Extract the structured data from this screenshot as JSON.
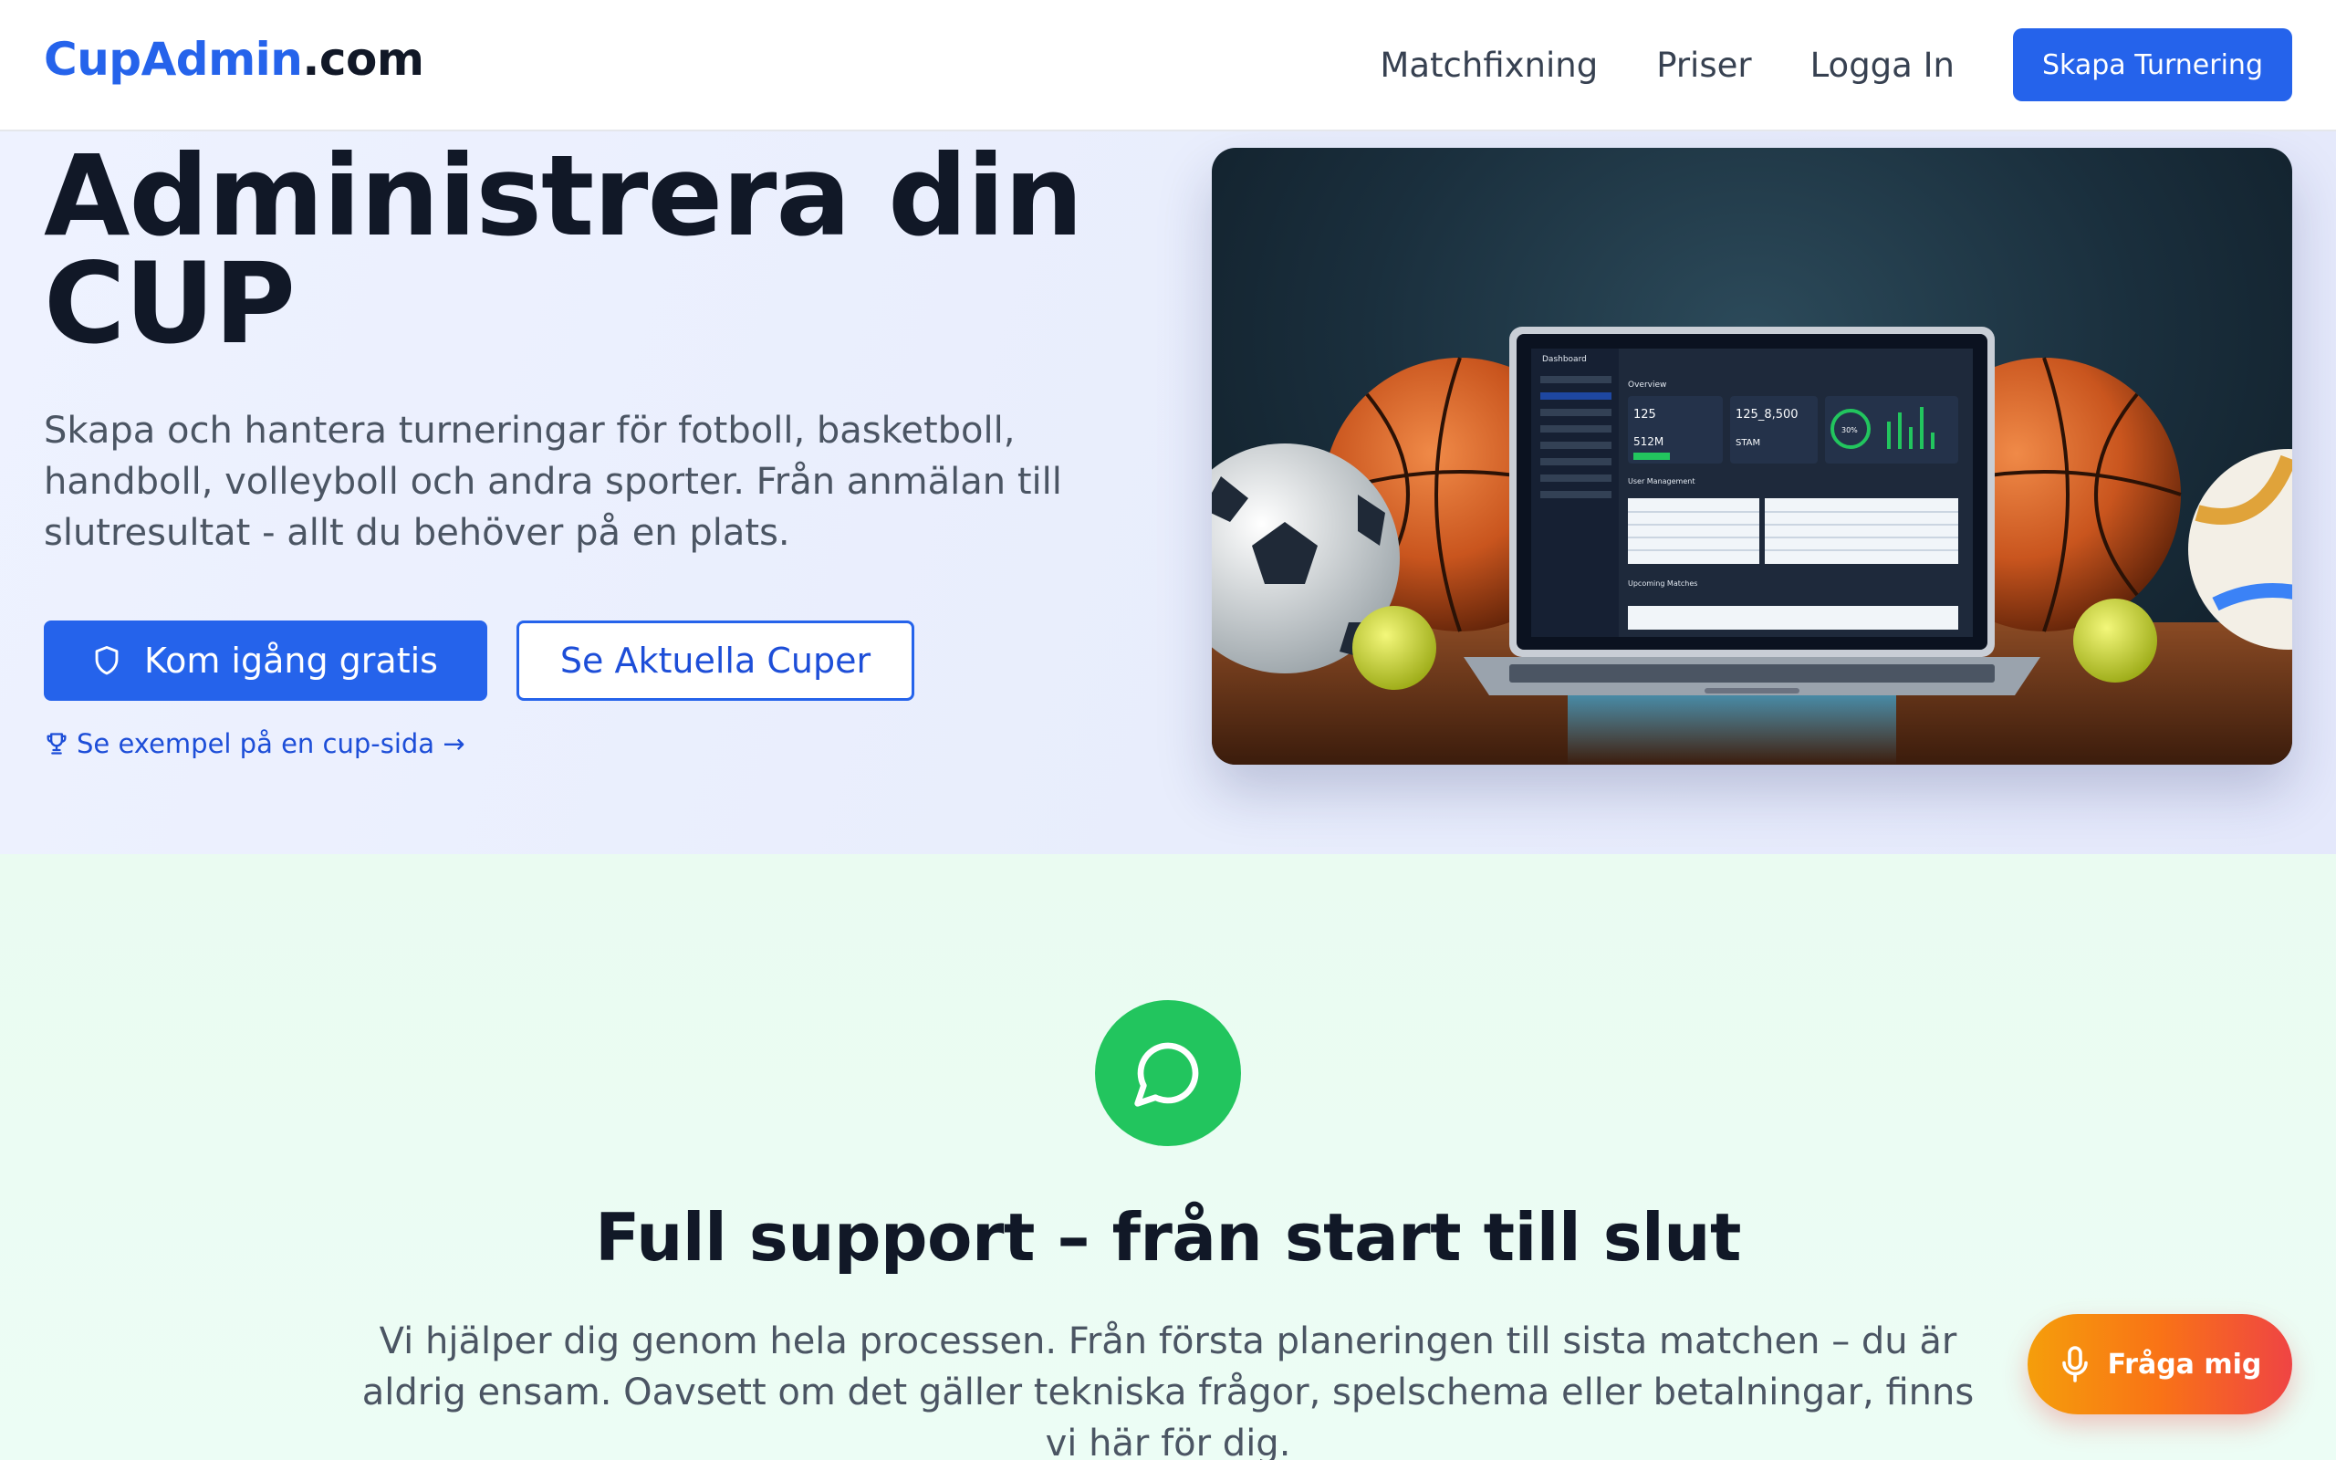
{
  "header": {
    "logo_brand": "CupAdmin",
    "logo_tld": ".com",
    "nav": [
      "Matchfixning",
      "Priser",
      "Logga In"
    ],
    "cta_label": "Skapa Turnering"
  },
  "hero": {
    "title": "Administrera din CUP",
    "description": "Skapa och hantera turneringar för fotboll, basketboll, handboll, volleyboll och andra sporter. Från anmälan till slutresultat - allt du behöver på en plats.",
    "primary_button": "Kom igång gratis",
    "secondary_button": "Se Aktuella Cuper",
    "example_link": "Se exempel på en cup-sida →",
    "image": {
      "dashboard_title": "Dashboard",
      "overview_label": "Overview",
      "stat_1": "125",
      "stat_2": "125_8,500",
      "stat_3": "512M",
      "stat_4": "STAM",
      "gauge": "30%",
      "section_1": "User Management",
      "section_2": "Upcoming Matches"
    }
  },
  "support": {
    "title": "Full support – från start till slut",
    "description": "Vi hjälper dig genom hela processen. Från första planeringen till sista matchen – du är aldrig ensam. Oavsett om det gäller tekniska frågor, spelschema eller betalningar, finns vi här för dig."
  },
  "assistant": {
    "label": "Fråga mig"
  },
  "colors": {
    "primary": "#2563eb",
    "support_icon": "#22c55e",
    "assistant_gradient_start": "#f59e0b",
    "assistant_gradient_end": "#ef4444"
  }
}
